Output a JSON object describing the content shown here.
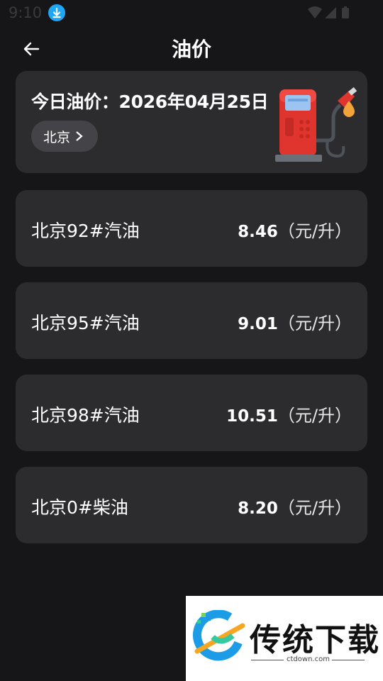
{
  "status": {
    "time": "9:10"
  },
  "header": {
    "title": "油价"
  },
  "today": {
    "label": "今日油价：2026年04月25日",
    "city": "北京"
  },
  "prices": [
    {
      "name": "北京92#汽油",
      "value": "8.46",
      "unit": "（元/升）"
    },
    {
      "name": "北京95#汽油",
      "value": "9.01",
      "unit": "（元/升）"
    },
    {
      "name": "北京98#汽油",
      "value": "10.51",
      "unit": "（元/升）"
    },
    {
      "name": "北京0#柴油",
      "value": "8.20",
      "unit": "（元/升）"
    }
  ],
  "watermark": {
    "brand": "传统下载",
    "url": "ctdown.com"
  },
  "colors": {
    "background": "#161618",
    "card": "#2c2c2f",
    "pump_red": "#e0352e",
    "download_blue": "#1ea7f5",
    "drop_orange": "#f2a33a"
  },
  "icons": [
    "back-arrow-icon",
    "download-icon",
    "wifi-icon",
    "signal-icon",
    "battery-icon",
    "chevron-right-icon",
    "fuel-pump-icon",
    "oil-drop-icon"
  ]
}
